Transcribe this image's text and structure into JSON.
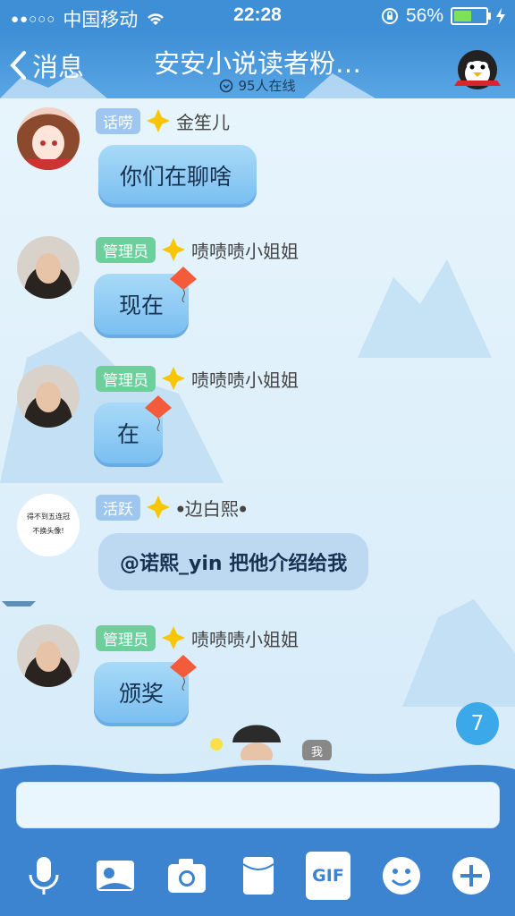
{
  "status": {
    "carrier": "中国移动",
    "time": "22:28",
    "battery": "56%",
    "battery_level": 0.56
  },
  "header": {
    "back_label": "消息",
    "title": "安安小说读者粉…",
    "online_count": "95人在线"
  },
  "messages": [
    {
      "badge": "话唠",
      "name": "金笙儿",
      "text": "你们在聊啥"
    },
    {
      "badge": "管理员",
      "name": "啧啧啧小姐姐",
      "text": "现在"
    },
    {
      "badge": "管理员",
      "name": "啧啧啧小姐姐",
      "text": "在"
    },
    {
      "badge": "活跃",
      "name": "ꔷ边白熙ꔷ",
      "text": "@诺熙_yin 把他介绍给我",
      "avatar_text": "得不到五连冠\n不换头像!"
    },
    {
      "badge": "管理员",
      "name": "啧啧啧小姐姐",
      "text": "颁奖"
    }
  ],
  "unread_count": "7",
  "me_label": "我",
  "colors": {
    "primary": "#3f8fd7",
    "bubble": "#8ccbf4",
    "admin_badge": "#6ccf9c",
    "chatter_badge": "#9ec6ee"
  },
  "toolbar": {
    "items": [
      "microphone-icon",
      "image-icon",
      "camera-icon",
      "red-packet-icon",
      "gif-icon",
      "emoji-icon",
      "plus-icon"
    ],
    "gif_label": "GIF"
  }
}
